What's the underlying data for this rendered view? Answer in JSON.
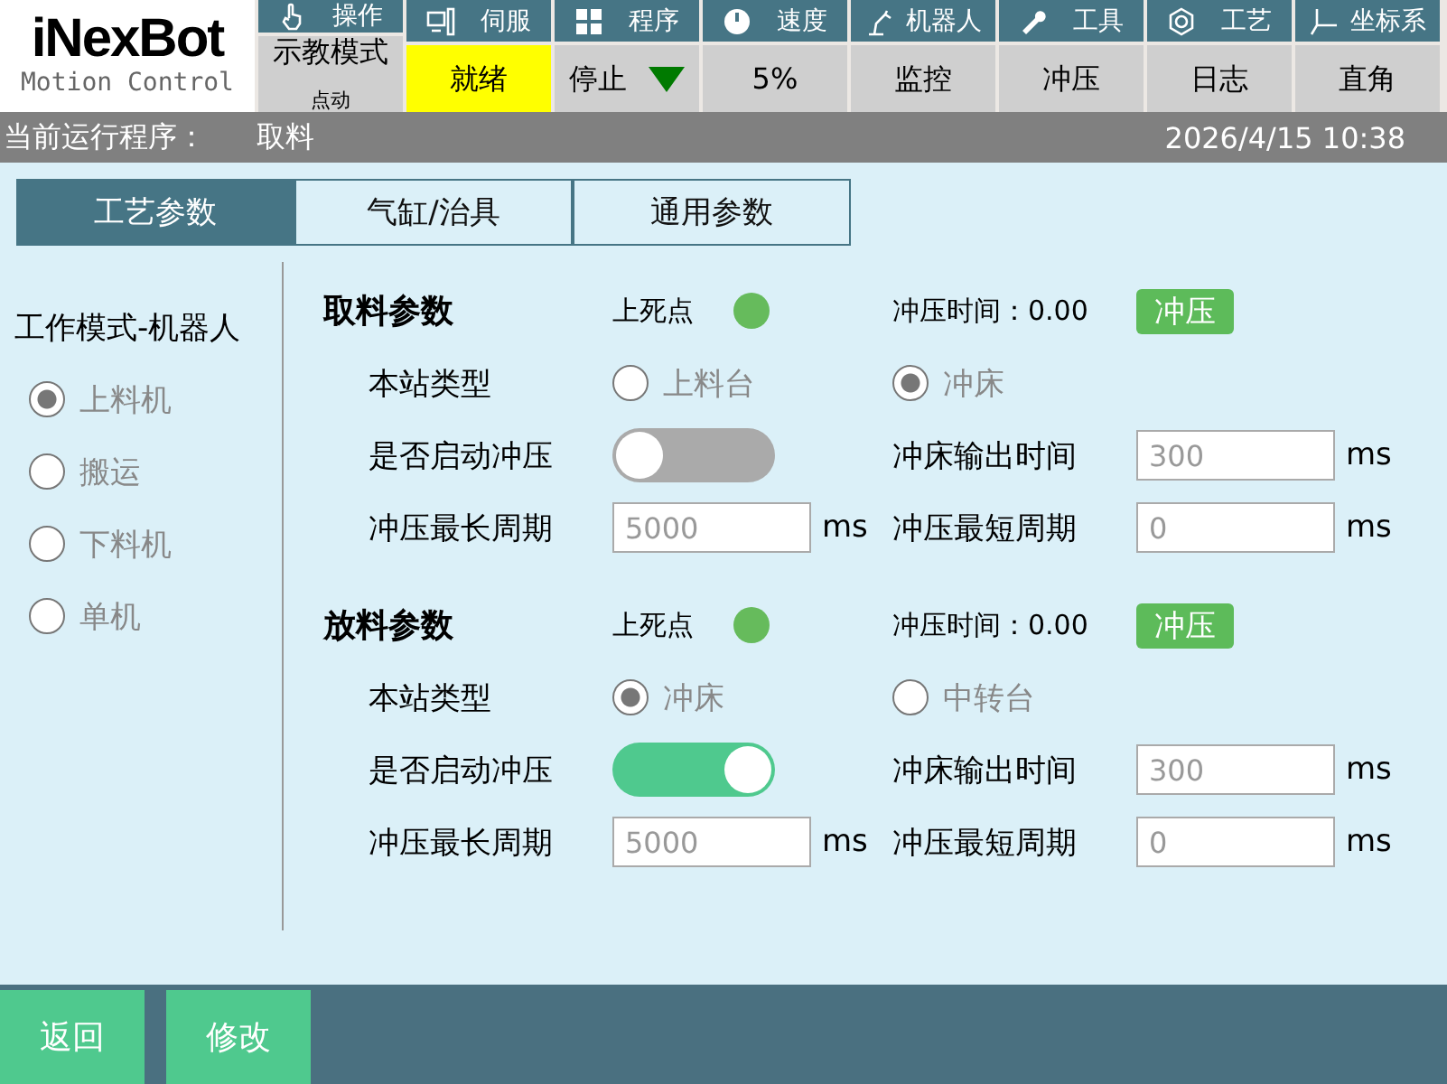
{
  "logo": {
    "brand": "iNexBot",
    "tagline": "Motion Control"
  },
  "top_menu": [
    {
      "label": "操作",
      "value": "示教模式",
      "sub": "点动"
    },
    {
      "label": "伺服",
      "value": "就绪",
      "color": "#ffff00"
    },
    {
      "label": "程序",
      "value": "停止",
      "dropdown": true
    },
    {
      "label": "速度",
      "value": "5%"
    },
    {
      "label": "机器人",
      "value": "监控"
    },
    {
      "label": "工具",
      "value": "冲压"
    },
    {
      "label": "工艺",
      "value": "日志"
    },
    {
      "label": "坐标系",
      "value": "直角"
    }
  ],
  "status_bar": {
    "program_label": "当前运行程序：",
    "program": "取料",
    "datetime": "2026/4/15 10:38"
  },
  "tabs": [
    {
      "label": "工艺参数",
      "selected": true
    },
    {
      "label": "气缸/治具",
      "selected": false
    },
    {
      "label": "通用参数",
      "selected": false
    }
  ],
  "work_mode": {
    "title": "工作模式-机器人",
    "disabled": true,
    "options": [
      {
        "label": "上料机",
        "selected": true
      },
      {
        "label": "搬运",
        "selected": false
      },
      {
        "label": "下料机",
        "selected": false
      },
      {
        "label": "单机",
        "selected": false
      }
    ]
  },
  "sections": [
    {
      "title": "取料参数",
      "dead_point": {
        "label": "上死点",
        "on": true
      },
      "press_time": "冲压时间：0.00",
      "press_button": "冲压",
      "station_type": {
        "label": "本站类型",
        "disabled": true,
        "options": [
          {
            "label": "上料台",
            "selected": false
          },
          {
            "label": "冲床",
            "selected": true
          }
        ]
      },
      "enable_press": {
        "label": "是否启动冲压",
        "on": false
      },
      "output_time": {
        "label": "冲床输出时间",
        "value": "300",
        "unit": "ms"
      },
      "max_cycle": {
        "label": "冲压最长周期",
        "value": "5000",
        "unit": "ms"
      },
      "min_cycle": {
        "label": "冲压最短周期",
        "value": "0",
        "unit": "ms"
      }
    },
    {
      "title": "放料参数",
      "dead_point": {
        "label": "上死点",
        "on": true
      },
      "press_time": "冲压时间：0.00",
      "press_button": "冲压",
      "station_type": {
        "label": "本站类型",
        "disabled": true,
        "options": [
          {
            "label": "冲床",
            "selected": true
          },
          {
            "label": "中转台",
            "selected": false
          }
        ]
      },
      "enable_press": {
        "label": "是否启动冲压",
        "on": true
      },
      "output_time": {
        "label": "冲床输出时间",
        "value": "300",
        "unit": "ms"
      },
      "max_cycle": {
        "label": "冲压最长周期",
        "value": "5000",
        "unit": "ms"
      },
      "min_cycle": {
        "label": "冲压最短周期",
        "value": "0",
        "unit": "ms"
      }
    }
  ],
  "bottom_buttons": [
    "返回",
    "修改"
  ]
}
